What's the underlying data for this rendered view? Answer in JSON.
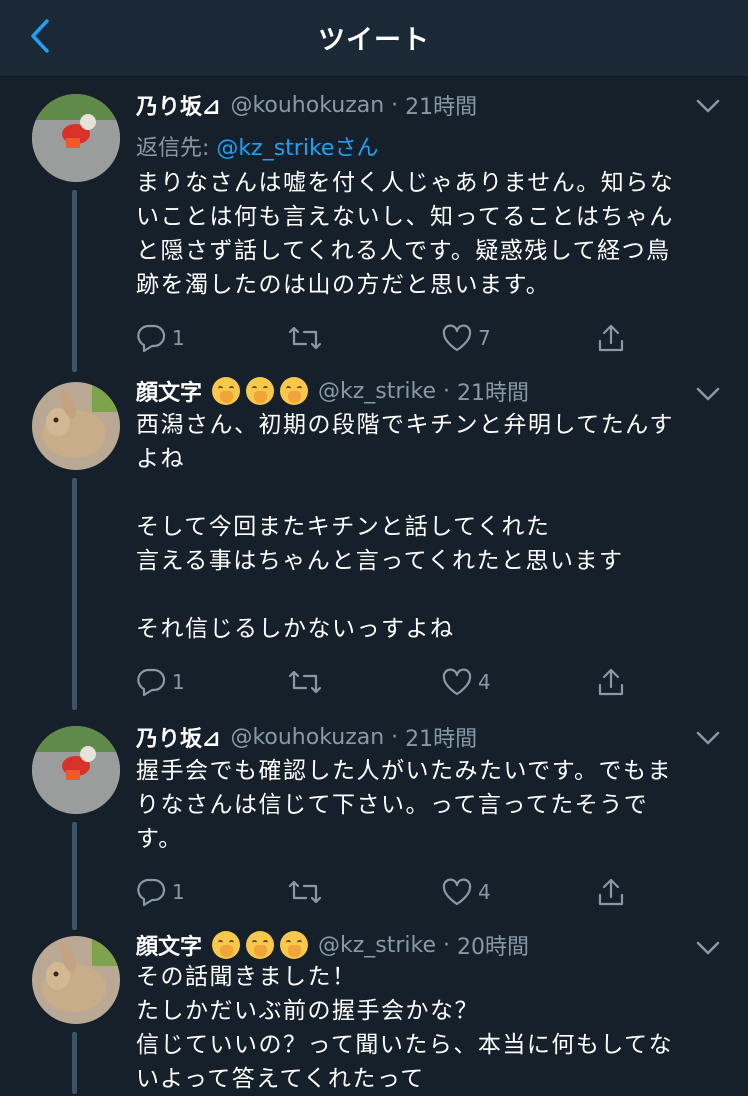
{
  "header": {
    "title": "ツイート"
  },
  "tweets": [
    {
      "name": "乃り坂⊿",
      "handle": "@kouhokuzan",
      "time": "21時間",
      "reply_label": "返信先:",
      "reply_target": "@kz_strikeさん",
      "text": "まりなさんは嘘を付く人じゃありません。知らな\nいことは何も言えないし、知ってることはちゃん\nと隠さず話してくれる人です。疑惑残して経つ鳥\n跡を濁したのは山の方だと思います。",
      "replies": "1",
      "retweets": "",
      "likes": "7"
    },
    {
      "name": "顔文字",
      "handle": "@kz_strike",
      "time": "21時間",
      "text": "西潟さん、初期の段階でキチンと弁明してたんす\nよね\n\nそして今回またキチンと話してくれた\n言える事はちゃんと言ってくれたと思います\n\nそれ信じるしかないっすよね",
      "replies": "1",
      "retweets": "",
      "likes": "4"
    },
    {
      "name": "乃り坂⊿",
      "handle": "@kouhokuzan",
      "time": "21時間",
      "text": "握手会でも確認した人がいたみたいです。でもま\nりなさんは信じて下さい。って言ってたそうで\nす。",
      "replies": "1",
      "retweets": "",
      "likes": "4"
    },
    {
      "name": "顔文字",
      "handle": "@kz_strike",
      "time": "20時間",
      "text": "その話聞きました！\nたしかだいぶ前の握手会かな？\n信じていいの？って聞いたら、本当に何もしてな\nいよって答えてくれたって"
    }
  ],
  "colors": {
    "background": "#15202b",
    "header": "#1b2836",
    "secondary_text": "#8899a6",
    "link": "#1da1f2",
    "thread_line": "#3d5466"
  },
  "icons": [
    "back-chevron-icon",
    "caret-down-icon",
    "reply-icon",
    "retweet-icon",
    "like-icon",
    "share-icon",
    "shushing-face-emoji"
  ]
}
